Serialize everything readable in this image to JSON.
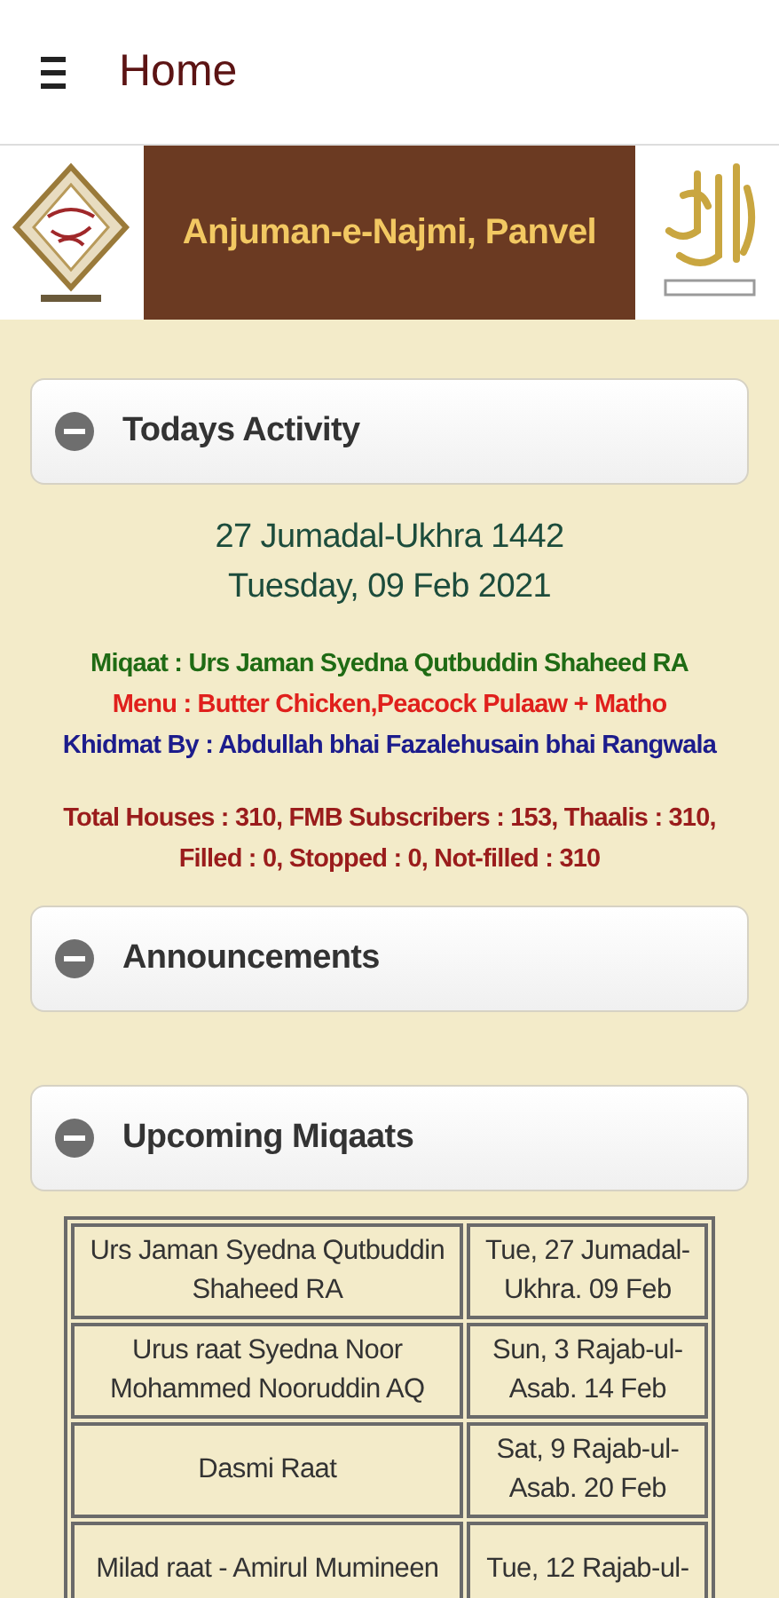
{
  "header": {
    "title": "Home"
  },
  "banner": {
    "title": "Anjuman-e-Najmi, Panvel"
  },
  "sections": [
    {
      "kind": "activity",
      "title": "Todays Activity",
      "expanded": true,
      "hijri_date": "27 Jumadal-Ukhra 1442",
      "date": "Tuesday, 09 Feb 2021",
      "lines": [
        {
          "text": "Miqaat : Urs Jaman Syedna Qutbuddin Shaheed RA",
          "color": "#1f6b14"
        },
        {
          "text": "Menu : Butter Chicken,Peacock Pulaaw + Matho",
          "color": "#e0201c"
        },
        {
          "text": "Khidmat By : Abdullah bhai Fazalehusain bhai Rangwala",
          "color": "#1c1c8c"
        }
      ],
      "stats": "Total Houses : 310, FMB Subscribers : 153, Thaalis : 310, Filled : 0, Stopped : 0, Not-filled : 310"
    },
    {
      "kind": "announcements",
      "title": "Announcements",
      "expanded": true
    },
    {
      "kind": "miqaats",
      "title": "Upcoming Miqaats",
      "expanded": true,
      "rows": [
        [
          "Urs Jaman Syedna Qutbuddin Shaheed RA",
          "Tue, 27 Jumadal-Ukhra. 09 Feb"
        ],
        [
          "Urus raat Syedna Noor Mohammed Nooruddin AQ",
          "Sun, 3 Rajab-ul-Asab. 14 Feb"
        ],
        [
          "Dasmi Raat",
          "Sat, 9 Rajab-ul-Asab. 20 Feb"
        ],
        [
          "Milad raat - Amirul Mumineen",
          "Tue, 12 Rajab-ul-"
        ]
      ]
    }
  ]
}
